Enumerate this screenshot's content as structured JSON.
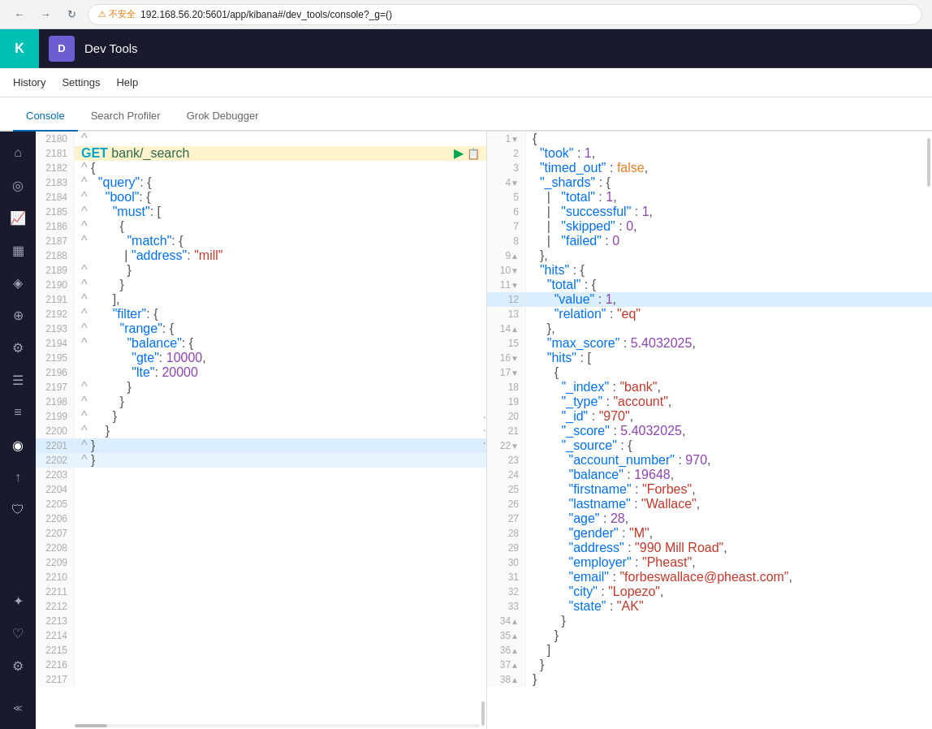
{
  "browser": {
    "url": "192.168.56.20:5601/app/kibana#/dev_tools/console?_g=()",
    "warning": "不安全",
    "back_label": "←",
    "forward_label": "→",
    "reload_label": "↺"
  },
  "app": {
    "title": "Dev Tools",
    "logo": "K",
    "avatar": "D"
  },
  "top_nav": {
    "items": [
      "History",
      "Settings",
      "Help"
    ]
  },
  "tabs": [
    {
      "label": "Console",
      "active": true
    },
    {
      "label": "Search Profiler",
      "active": false
    },
    {
      "label": "Grok Debugger",
      "active": false
    }
  ],
  "sidebar_icons": [
    {
      "name": "home-icon",
      "symbol": "⌂"
    },
    {
      "name": "discover-icon",
      "symbol": "○"
    },
    {
      "name": "visualize-icon",
      "symbol": "📊"
    },
    {
      "name": "dashboard-icon",
      "symbol": "▦"
    },
    {
      "name": "canvas-icon",
      "symbol": "◈"
    },
    {
      "name": "maps-icon",
      "symbol": "⊕"
    },
    {
      "name": "ml-icon",
      "symbol": "⚙"
    },
    {
      "name": "infrastructure-icon",
      "symbol": "≡"
    },
    {
      "name": "logs-icon",
      "symbol": "≡"
    },
    {
      "name": "apm-icon",
      "symbol": "◎"
    },
    {
      "name": "uptime-icon",
      "symbol": "↑"
    },
    {
      "name": "siem-icon",
      "symbol": "⛨"
    },
    {
      "name": "devtools-icon",
      "symbol": "✦"
    },
    {
      "name": "monitoring-icon",
      "symbol": "♡"
    },
    {
      "name": "settings-icon",
      "symbol": "⚙"
    }
  ],
  "editor": {
    "lines": [
      {
        "num": "2180",
        "content": "^",
        "highlight": false
      },
      {
        "num": "2181",
        "type": "request",
        "content": "GET bank/_search",
        "highlight": false
      },
      {
        "num": "2182",
        "content": "^ {",
        "highlight": false
      },
      {
        "num": "2183",
        "content": "^   \"query\": {",
        "highlight": false
      },
      {
        "num": "2184",
        "content": "^     \"bool\": {",
        "highlight": false
      },
      {
        "num": "2185",
        "content": "^       \"must\": [",
        "highlight": false
      },
      {
        "num": "2186",
        "content": "^         {",
        "highlight": false
      },
      {
        "num": "2187",
        "content": "^           \"match\": {",
        "highlight": false
      },
      {
        "num": "2188",
        "content": "              \"address\": \"mill\"",
        "highlight": false
      },
      {
        "num": "2189",
        "content": "^           }",
        "highlight": false
      },
      {
        "num": "2190",
        "content": "^         }",
        "highlight": false
      },
      {
        "num": "2191",
        "content": "^       ],",
        "highlight": false
      },
      {
        "num": "2192",
        "content": "^       \"filter\": {",
        "highlight": false
      },
      {
        "num": "2193",
        "content": "^         \"range\": {",
        "highlight": false
      },
      {
        "num": "2194",
        "content": "^           \"balance\": {",
        "highlight": false
      },
      {
        "num": "2195",
        "content": "              \"gte\": 10000,",
        "highlight": false
      },
      {
        "num": "2196",
        "content": "              \"lte\": 20000",
        "highlight": false
      },
      {
        "num": "2197",
        "content": "^           }",
        "highlight": false
      },
      {
        "num": "2198",
        "content": "^         }",
        "highlight": false
      },
      {
        "num": "2199",
        "content": "^       }",
        "highlight": false
      },
      {
        "num": "2200",
        "content": "^     }",
        "highlight": false
      },
      {
        "num": "2201",
        "content": "^ }",
        "highlight": true,
        "active": true
      },
      {
        "num": "2202",
        "content": "^ }",
        "highlight": false
      },
      {
        "num": "2203",
        "content": "",
        "highlight": false
      },
      {
        "num": "2204",
        "content": "",
        "highlight": false
      },
      {
        "num": "2205",
        "content": "",
        "highlight": false
      },
      {
        "num": "2206",
        "content": "",
        "highlight": false
      },
      {
        "num": "2207",
        "content": "",
        "highlight": false
      },
      {
        "num": "2208",
        "content": "",
        "highlight": false
      },
      {
        "num": "2209",
        "content": "",
        "highlight": false
      },
      {
        "num": "2210",
        "content": "",
        "highlight": false
      },
      {
        "num": "2211",
        "content": "",
        "highlight": false
      },
      {
        "num": "2212",
        "content": "",
        "highlight": false
      },
      {
        "num": "2213",
        "content": "",
        "highlight": false
      },
      {
        "num": "2214",
        "content": "",
        "highlight": false
      },
      {
        "num": "2215",
        "content": "",
        "highlight": false
      },
      {
        "num": "2216",
        "content": "",
        "highlight": false
      },
      {
        "num": "2217",
        "content": "",
        "highlight": false
      }
    ]
  },
  "result": {
    "lines": [
      {
        "num": "1",
        "fold": true,
        "content": "{"
      },
      {
        "num": "2",
        "fold": false,
        "content": "  \"took\" : 1,"
      },
      {
        "num": "3",
        "fold": false,
        "content": "  \"timed_out\" : false,"
      },
      {
        "num": "4",
        "fold": true,
        "content": "  \"_shards\" : {"
      },
      {
        "num": "5",
        "fold": false,
        "content": "    \"total\" : 1,"
      },
      {
        "num": "6",
        "fold": false,
        "content": "    \"successful\" : 1,"
      },
      {
        "num": "7",
        "fold": false,
        "content": "    \"skipped\" : 0,"
      },
      {
        "num": "8",
        "fold": false,
        "content": "    \"failed\" : 0"
      },
      {
        "num": "9",
        "fold": true,
        "content": "  },"
      },
      {
        "num": "10",
        "fold": true,
        "content": "  \"hits\" : {"
      },
      {
        "num": "11",
        "fold": true,
        "content": "    \"total\" : {"
      },
      {
        "num": "12",
        "fold": false,
        "content": "      \"value\" : 1,",
        "active": true
      },
      {
        "num": "13",
        "fold": false,
        "content": "      \"relation\" : \"eq\""
      },
      {
        "num": "14",
        "fold": true,
        "content": "    },"
      },
      {
        "num": "15",
        "fold": false,
        "content": "    \"max_score\" : 5.4032025,"
      },
      {
        "num": "16",
        "fold": true,
        "content": "    \"hits\" : ["
      },
      {
        "num": "17",
        "fold": true,
        "content": "      {"
      },
      {
        "num": "18",
        "fold": false,
        "content": "        \"_index\" : \"bank\","
      },
      {
        "num": "19",
        "fold": false,
        "content": "        \"_type\" : \"account\","
      },
      {
        "num": "20",
        "fold": false,
        "content": "        \"_id\" : \"970\","
      },
      {
        "num": "21",
        "fold": false,
        "content": "        \"_score\" : 5.4032025,"
      },
      {
        "num": "22",
        "fold": true,
        "content": "        \"_source\" : {"
      },
      {
        "num": "23",
        "fold": false,
        "content": "          \"account_number\" : 970,"
      },
      {
        "num": "24",
        "fold": false,
        "content": "          \"balance\" : 19648,"
      },
      {
        "num": "25",
        "fold": false,
        "content": "          \"firstname\" : \"Forbes\","
      },
      {
        "num": "26",
        "fold": false,
        "content": "          \"lastname\" : \"Wallace\","
      },
      {
        "num": "27",
        "fold": false,
        "content": "          \"age\" : 28,"
      },
      {
        "num": "28",
        "fold": false,
        "content": "          \"gender\" : \"M\","
      },
      {
        "num": "29",
        "fold": false,
        "content": "          \"address\" : \"990 Mill Road\","
      },
      {
        "num": "30",
        "fold": false,
        "content": "          \"employer\" : \"Pheast\","
      },
      {
        "num": "31",
        "fold": false,
        "content": "          \"email\" : \"forbeswallace@pheast.com\","
      },
      {
        "num": "32",
        "fold": false,
        "content": "          \"city\" : \"Lopezo\","
      },
      {
        "num": "33",
        "fold": false,
        "content": "          \"state\" : \"AK\""
      },
      {
        "num": "34",
        "fold": true,
        "content": "        }"
      },
      {
        "num": "35",
        "fold": true,
        "content": "      }"
      },
      {
        "num": "36",
        "fold": true,
        "content": "    ]"
      },
      {
        "num": "37",
        "fold": true,
        "content": "  }"
      },
      {
        "num": "38",
        "fold": true,
        "content": "}"
      }
    ]
  }
}
